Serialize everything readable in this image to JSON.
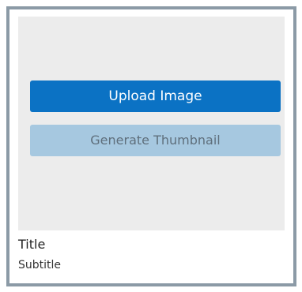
{
  "card": {
    "upload_button_label": "Upload Image",
    "generate_button_label": "Generate Thumbnail",
    "title": "Title",
    "subtitle": "Subtitle"
  },
  "colors": {
    "card_border": "#8b9aa6",
    "image_placeholder_bg": "#ececec",
    "primary_button_bg": "#0b72c4",
    "disabled_button_bg": "#a6c8e0"
  }
}
